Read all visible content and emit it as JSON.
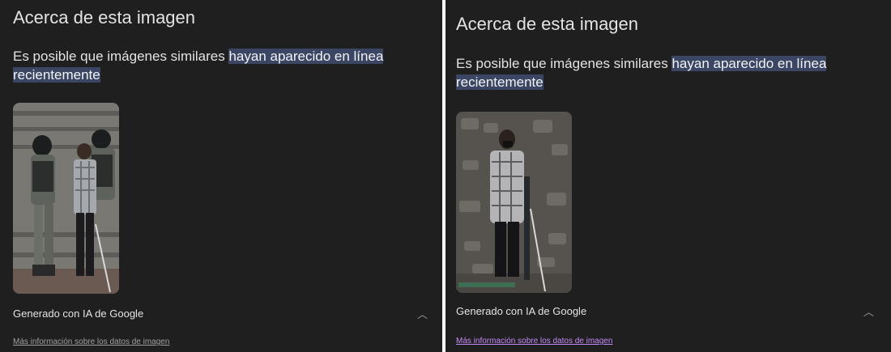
{
  "left": {
    "title": "Acerca de esta imagen",
    "desc_plain": "Es posible que imágenes similares ",
    "desc_highlight_1": "hayan aparecido en línea",
    "desc_highlight_2": "recientemente",
    "image_icon": "photo-three-men-stairs",
    "generated_label": "Generado con IA de Google",
    "chevron_icon": "chevron-up-icon",
    "more_link": "Más información sobre los datos de imagen"
  },
  "right": {
    "title": "Acerca de esta imagen",
    "desc_plain": "Es posible que imágenes similares ",
    "desc_highlight_1": "hayan aparecido en línea",
    "desc_highlight_2": "recientemente",
    "image_icon": "photo-man-with-cane",
    "generated_label": "Generado con IA de Google",
    "chevron_icon": "chevron-up-icon",
    "more_link": "Más información sobre los datos de imagen"
  },
  "colors": {
    "background": "#1f1f1f",
    "text": "#e3e3e3",
    "highlight": "#3b4664",
    "link_left": "#a0a0a0",
    "link_right": "#c58af9"
  }
}
